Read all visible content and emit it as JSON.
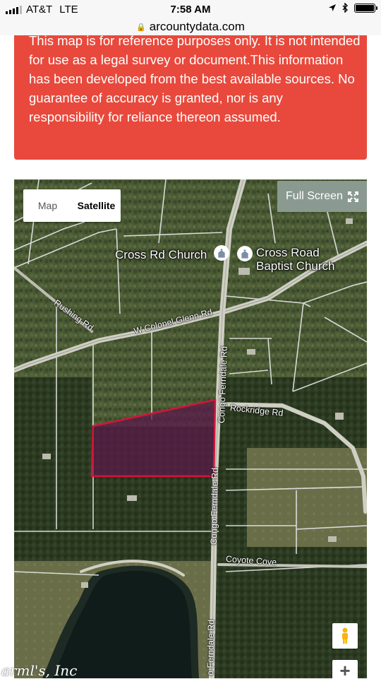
{
  "status_bar": {
    "carrier": "AT&T",
    "network": "LTE",
    "time": "7:58 AM"
  },
  "browser": {
    "url": "arcountydata.com"
  },
  "disclaimer": {
    "text": "This map is for reference purposes only. It is not intended for use as a legal survey or document.This information has been developed from the best available sources. No guarantee of accuracy is granted, nor is any responsibility for reliance thereon assumed."
  },
  "map": {
    "type_control": {
      "map_label": "Map",
      "satellite_label": "Satellite",
      "selected": "Satellite"
    },
    "fullscreen_label": "Full Screen",
    "zoom_in_label": "+",
    "pois": [
      {
        "name": "Cross Rd Church",
        "icon": "church-icon"
      },
      {
        "name": "Cross Road Baptist Church",
        "icon": "church-icon"
      }
    ],
    "roads": {
      "rushing": "Rushing Rd",
      "colonel_glenn": "W Colonel Glenn Rd",
      "congo_ferndale_upper": "Congo Ferndale Rd",
      "congo_ferndale_mid": "Congo Ferndale Rd",
      "congo_ferndale_lower": "o Ferndale Rd",
      "rockridge": "Rockridge Rd",
      "coyote": "Coyote Cove"
    },
    "parcel_color": "#d4143a",
    "accent_color": "#e8493c"
  },
  "watermark": "arml's, Inc"
}
